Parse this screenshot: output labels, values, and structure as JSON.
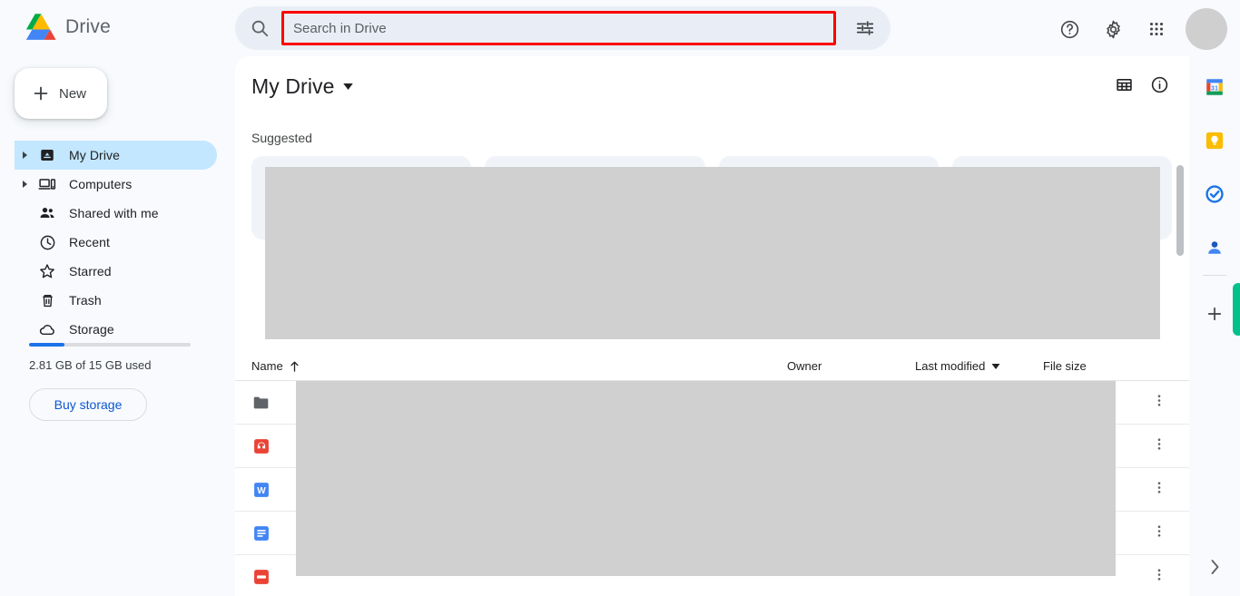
{
  "app": {
    "brand_name": "Drive",
    "accent_blue": "#1a73e8",
    "highlight_red": "#fb0000",
    "active_nav_bg": "#c2e7ff"
  },
  "search": {
    "placeholder": "Search in Drive",
    "value": "",
    "search_icon": "search-icon",
    "tune_icon": "tune-icon"
  },
  "top_right": {
    "help_icon": "help-icon",
    "settings_icon": "gear-icon",
    "apps_icon": "apps-grid-icon",
    "avatar": "avatar"
  },
  "sidebar": {
    "new_label": "New",
    "items": [
      {
        "label": "My Drive",
        "icon": "my-drive-icon",
        "caret": true,
        "active": true
      },
      {
        "label": "Computers",
        "icon": "computers-icon",
        "caret": true,
        "active": false
      },
      {
        "label": "Shared with me",
        "icon": "shared-with-me-icon",
        "caret": false,
        "active": false
      },
      {
        "label": "Recent",
        "icon": "clock-icon",
        "caret": false,
        "active": false
      },
      {
        "label": "Starred",
        "icon": "star-icon",
        "caret": false,
        "active": false
      },
      {
        "label": "Trash",
        "icon": "trash-icon",
        "caret": false,
        "active": false
      },
      {
        "label": "Storage",
        "icon": "cloud-icon",
        "caret": false,
        "active": false
      }
    ],
    "storage": {
      "used_text": "2.81 GB of 15 GB used",
      "percent": 22,
      "buy_label": "Buy storage"
    }
  },
  "main": {
    "page_title": "My Drive",
    "title_caret": "chevron-down-icon",
    "grid_view_icon": "grid-view-icon",
    "info_icon": "info-icon",
    "suggested_label": "Suggested",
    "suggested_cards": 4,
    "table": {
      "columns": [
        {
          "key": "name",
          "label": "Name",
          "sort": "asc"
        },
        {
          "key": "owner",
          "label": "Owner",
          "sort": null
        },
        {
          "key": "last_modified",
          "label": "Last modified",
          "sort": "menu"
        },
        {
          "key": "file_size",
          "label": "File size",
          "sort": null
        }
      ],
      "rows": [
        {
          "icon": "folder-icon",
          "name": "",
          "owner": "",
          "last_modified": "",
          "file_size": ""
        },
        {
          "icon": "audio-file-icon",
          "name": "",
          "owner": "",
          "last_modified": "",
          "file_size": ""
        },
        {
          "icon": "word-doc-icon",
          "name": "",
          "owner": "",
          "last_modified": "",
          "file_size": ""
        },
        {
          "icon": "google-docs-icon",
          "name": "",
          "owner": "",
          "last_modified": "",
          "file_size": ""
        },
        {
          "icon": "pdf-file-icon",
          "name": "",
          "owner": "",
          "last_modified": "",
          "file_size": ""
        }
      ],
      "row_menu_icon": "more-vert-icon"
    }
  },
  "right_rail": {
    "items": [
      {
        "icon": "google-calendar-icon"
      },
      {
        "icon": "google-keep-icon"
      },
      {
        "icon": "google-tasks-icon"
      },
      {
        "icon": "google-contacts-icon"
      }
    ],
    "add_icon": "plus-icon",
    "expand_icon": "chevron-right-icon"
  }
}
